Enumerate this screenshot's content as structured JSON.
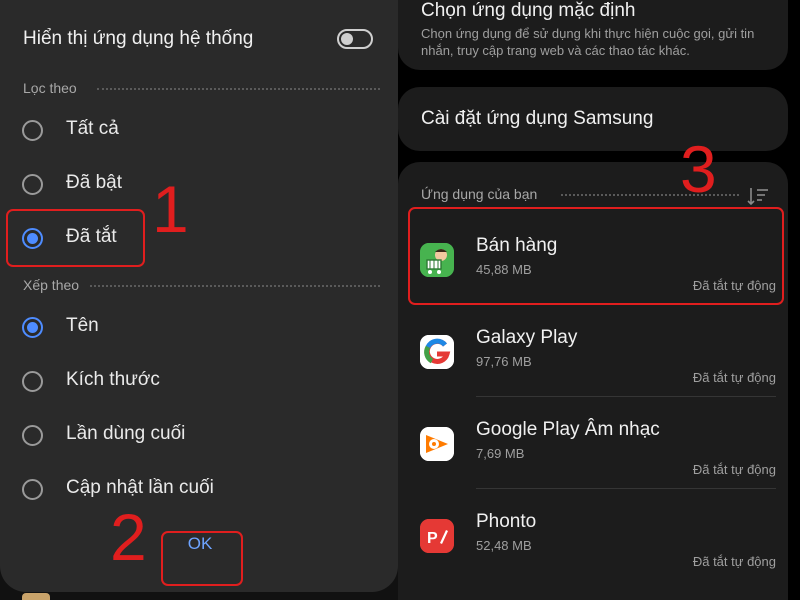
{
  "left_panel": {
    "show_system_apps_label": "Hiển thị ứng dụng hệ thống",
    "filter_section": "Lọc theo",
    "filter_options": [
      "Tất cả",
      "Đã bật",
      "Đã tắt"
    ],
    "filter_selected": "Đã tắt",
    "sort_section": "Xếp theo",
    "sort_options": [
      "Tên",
      "Kích thước",
      "Lần dùng cuối",
      "Cập nhật lần cuối"
    ],
    "sort_selected": "Tên",
    "ok_label": "OK"
  },
  "right_panel": {
    "default_apps_title": "Chọn ứng dụng mặc định",
    "default_apps_desc": "Chọn ứng dụng để sử dụng khi thực hiện cuộc gọi, gửi tin nhắn, truy cập trang web và các thao tác khác.",
    "samsung_settings_title": "Cài đặt ứng dụng Samsung",
    "your_apps_section": "Ứng dụng của bạn",
    "apps": [
      {
        "name": "Bán hàng",
        "size": "45,88 MB",
        "status": "Đã tắt tự động",
        "icon": "shopping-cart-icon"
      },
      {
        "name": "Galaxy Play",
        "size": "97,76 MB",
        "status": "Đã tắt tự động",
        "icon": "galaxy-play-icon"
      },
      {
        "name": "Google Play Âm nhạc",
        "size": "7,69 MB",
        "status": "Đã tắt tự động",
        "icon": "play-music-icon"
      },
      {
        "name": "Phonto",
        "size": "52,48 MB",
        "status": "Đã tắt tự động",
        "icon": "phonto-icon"
      }
    ]
  },
  "annotations": {
    "step1": "1",
    "step2": "2",
    "step3": "3",
    "highlight_color": "#e01e1e"
  },
  "colors": {
    "accent": "#4e8cff",
    "dialog_bg": "#2a2a2a",
    "card_bg": "#1c1c1c"
  }
}
